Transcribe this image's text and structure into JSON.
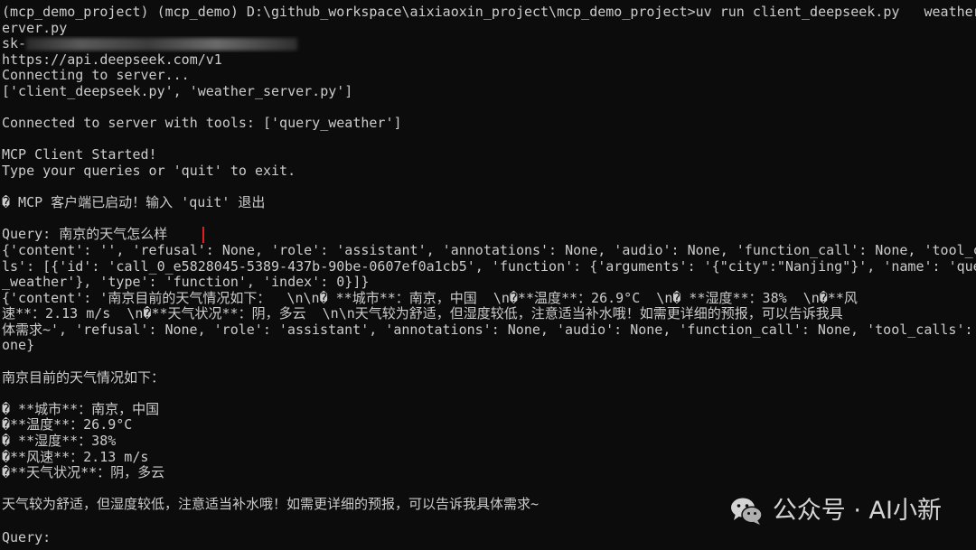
{
  "window": {
    "background": "#0c0c0c",
    "foreground": "#cccccc",
    "highlight_color": "#e02020"
  },
  "terminal": {
    "lines": [
      "(mcp_demo_project) (mcp_demo) D:\\github_workspace\\aixiaoxin_project\\mcp_demo_project>uv run client_deepseek.py   weather_s",
      "erver.py",
      "sk-",
      "https://api.deepseek.com/v1",
      "Connecting to server...",
      "['client_deepseek.py', 'weather_server.py']",
      "",
      "Connected to server with tools: ['query_weather']",
      "",
      "MCP Client Started!",
      "Type your queries or 'quit' to exit.",
      "",
      "� MCP 客户端已启动！输入 'quit' 退出",
      "",
      "Query: 南京的天气怎么样",
      "{'content': '', 'refusal': None, 'role': 'assistant', 'annotations': None, 'audio': None, 'function_call': None, 'tool_cal",
      "ls': [{'id': 'call_0_e5828045-5389-437b-90be-0607ef0a1cb5', 'function': {'arguments': '{\"city\":\"Nanjing\"}', 'name': 'query",
      "_weather'}, 'type': 'function', 'index': 0}]}",
      "{'content': '南京目前的天气情况如下：  \\n\\n� **城市**：南京，中国  \\n�**温度**：26.9°C  \\n� **湿度**：38%  \\n�**风",
      "速**：2.13 m/s  \\n�**天气状况**：阴，多云  \\n\\n天气较为舒适，但湿度较低，注意适当补水哦！如需更详细的预报，可以告诉我具",
      "体需求~', 'refusal': None, 'role': 'assistant', 'annotations': None, 'audio': None, 'function_call': None, 'tool_calls': N",
      "one}",
      "",
      "南京目前的天气情况如下：",
      "",
      "� **城市**：南京，中国",
      "�**温度**：26.9°C",
      "� **湿度**：38%",
      "�**风速**：2.13 m/s",
      "�**天气状况**：阴，多云",
      "",
      "天气较为舒适，但湿度较低，注意适当补水哦！如需更详细的预报，可以告诉我具体需求~",
      "",
      "Query: "
    ]
  },
  "watermark": {
    "text": "公众号 · AI小新",
    "icon": "wechat-icon"
  }
}
